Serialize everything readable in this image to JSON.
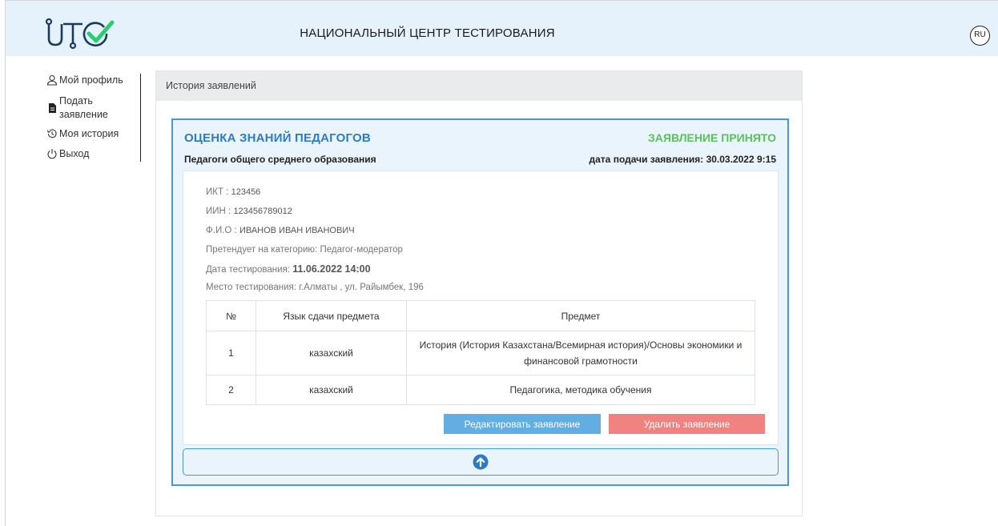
{
  "header": {
    "title": "НАЦИОНАЛЬНЫЙ ЦЕНТР ТЕСТИРОВАНИЯ",
    "lang": "RU",
    "logo_colors": {
      "dark": "#1a3b5c",
      "accent": "#2ecc71"
    }
  },
  "sidebar": {
    "items": [
      {
        "label": "Мой профиль",
        "icon": "user-icon"
      },
      {
        "label": "Подать заявление",
        "icon": "document-icon"
      },
      {
        "label": "Моя история",
        "icon": "history-icon"
      },
      {
        "label": "Выход",
        "icon": "power-icon"
      }
    ]
  },
  "main": {
    "section_title": "История заявлений"
  },
  "application": {
    "title": "ОЦЕНКА ЗНАНИЙ ПЕДАГОГОВ",
    "status": "ЗАЯВЛЕНИЕ ПРИНЯТО",
    "subtitle": "Педагоги общего среднего образования",
    "date_label": "дата подачи заявления: 30.03.2022 9:15",
    "ikt_label": "ИКТ :",
    "ikt_value": "123456",
    "iin_label": "ИИН :",
    "iin_value": "123456789012",
    "fio_label": "Ф.И.О :",
    "fio_value": "ИВАНОВ ИВАН ИВАНОВИЧ",
    "category_label": "Претендует на категорию:",
    "category_value": "Педагог-модератор",
    "test_date_label": "Дата тестирования:",
    "test_date_value": "11.06.2022 14:00",
    "place_label": "Место тестирования:",
    "place_value": "г.Алматы , ул. Райымбек, 196",
    "table": {
      "headers": [
        "№",
        "Язык сдачи предмета",
        "Предмет"
      ],
      "rows": [
        [
          "1",
          "казахский",
          "История (История Казахстана/Всемирная история)/Основы экономики и финансовой грамотности"
        ],
        [
          "2",
          "казахский",
          "Педагогика, методика обучения"
        ]
      ]
    },
    "edit_button": "Редактировать заявление",
    "delete_button": "Удалить заявление",
    "colors": {
      "title": "#2e7bc4",
      "status": "#5cc15d",
      "edit": "#62aee3",
      "delete": "#f08380"
    }
  }
}
